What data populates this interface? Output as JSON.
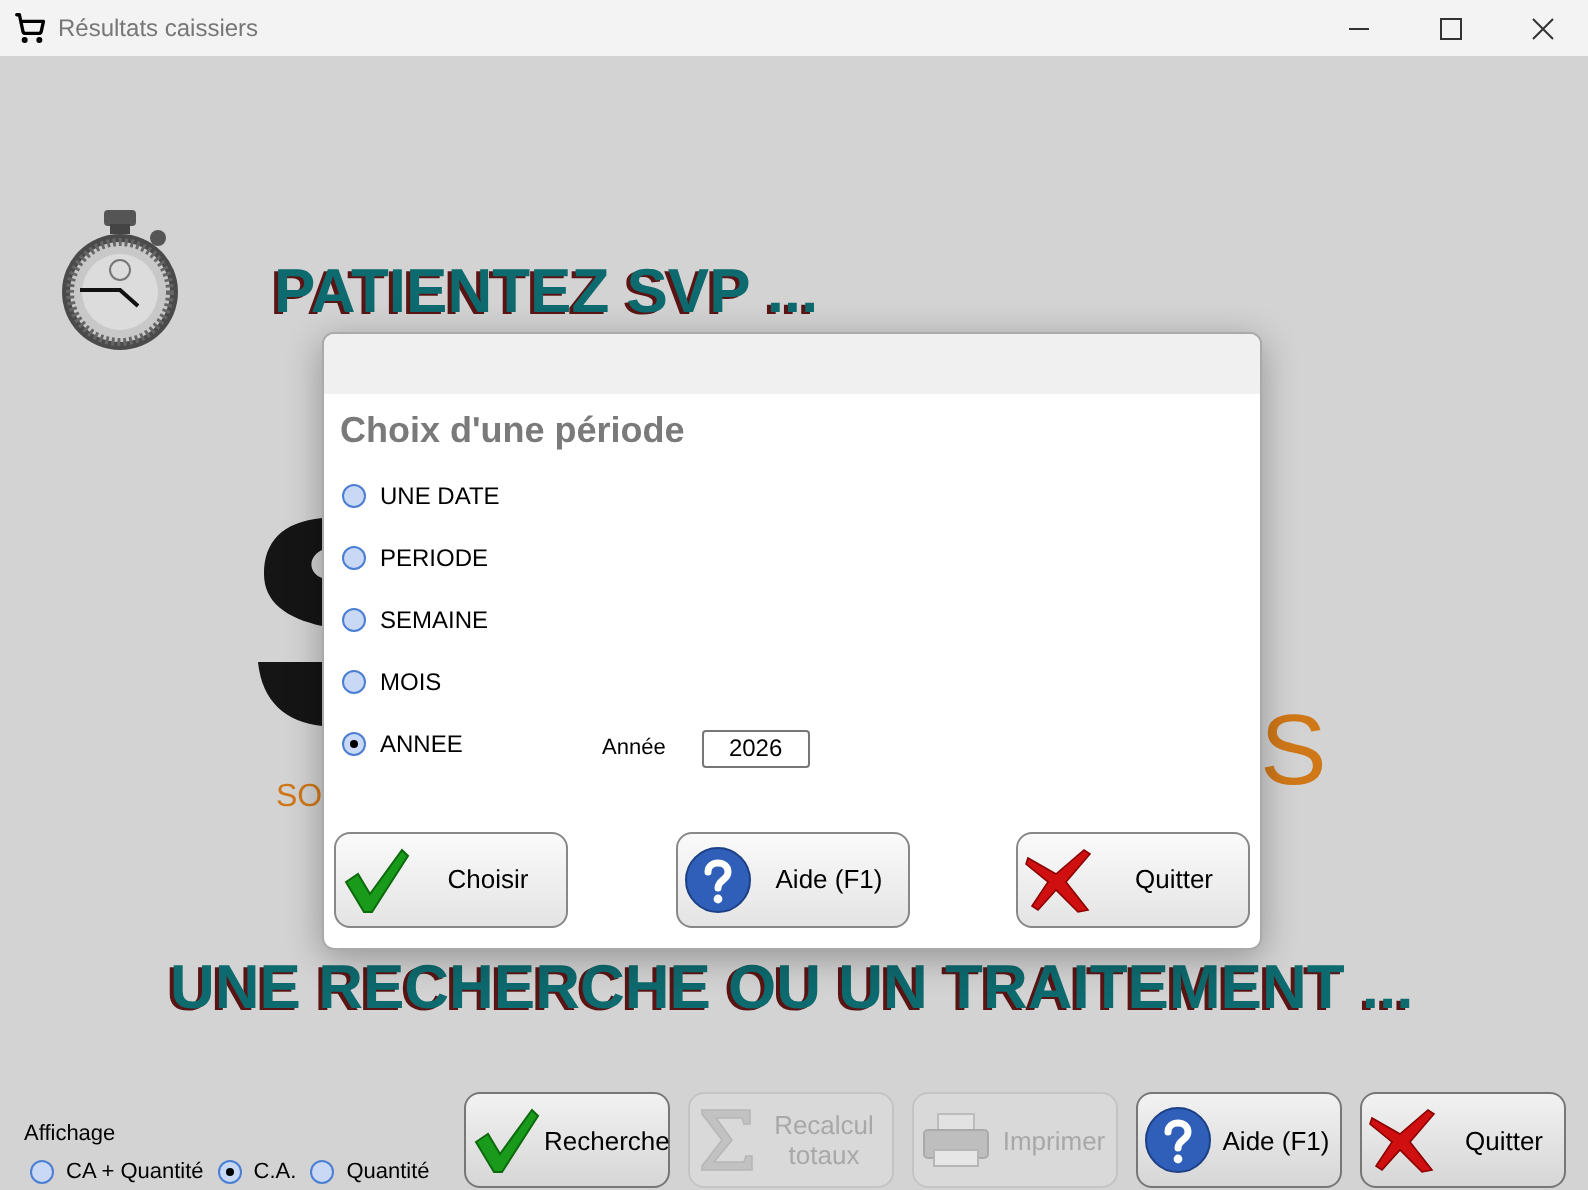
{
  "window": {
    "title": "Résultats caissiers"
  },
  "background": {
    "wait_message": "PATIENTEZ SVP ...",
    "logo_tagline": "SO",
    "logo_end": "S",
    "status_message": "UNE RECHERCHE OU UN TRAITEMENT ..."
  },
  "dialog": {
    "title": "Choix d'une période",
    "options": [
      {
        "label": "UNE DATE",
        "selected": false
      },
      {
        "label": "PERIODE",
        "selected": false
      },
      {
        "label": "SEMAINE",
        "selected": false
      },
      {
        "label": "MOIS",
        "selected": false
      },
      {
        "label": "ANNEE",
        "selected": true
      }
    ],
    "year_label": "Année",
    "year_value": "2026",
    "buttons": [
      {
        "label": "Choisir",
        "kind": "check"
      },
      {
        "label": "Aide (F1)",
        "kind": "help"
      },
      {
        "label": "Quitter",
        "kind": "quit"
      }
    ]
  },
  "display": {
    "label": "Affichage",
    "options": [
      {
        "label": "CA + Quantité",
        "selected": false
      },
      {
        "label": "C.A.",
        "selected": true
      },
      {
        "label": "Quantité",
        "selected": false
      }
    ]
  },
  "toolbar": [
    {
      "label": "Recherche",
      "kind": "check",
      "disabled": false
    },
    {
      "label": "Recalcul totaux",
      "kind": "sum",
      "disabled": true
    },
    {
      "label": "Imprimer",
      "kind": "print",
      "disabled": true
    },
    {
      "label": "Aide (F1)",
      "kind": "help",
      "disabled": false
    },
    {
      "label": "Quitter",
      "kind": "quit",
      "disabled": false
    }
  ]
}
